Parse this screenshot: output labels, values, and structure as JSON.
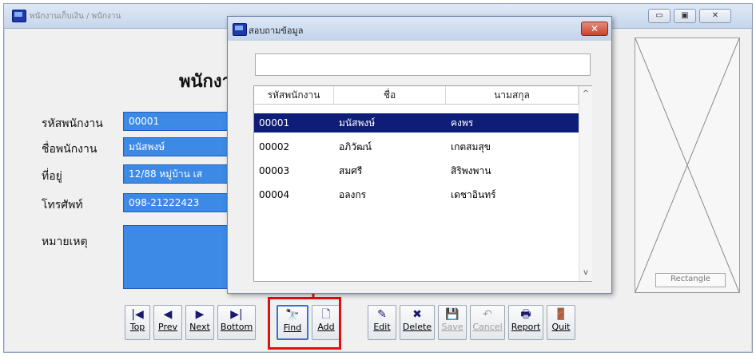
{
  "main_window": {
    "title": "พนักงานเก็บเงิน / พนักงาน",
    "minimize_glyph": "▭",
    "maximize_glyph": "▣",
    "close_glyph": "✕"
  },
  "form": {
    "title": "พนักงาน",
    "fields": [
      {
        "label": "รหัสพนักงาน",
        "value": "00001"
      },
      {
        "label": "ชื่อพนักงาน",
        "value": "มนัสพงษ์"
      },
      {
        "label": "ที่อยู่",
        "value": "12/88 หมู่บ้าน เส"
      },
      {
        "label": "โทรศัพท์",
        "value": "098-21222423"
      },
      {
        "label": "หมายเหตุ",
        "value": ""
      }
    ],
    "photo_caption": "Rectangle"
  },
  "toolbar": {
    "buttons": [
      {
        "label": "Top",
        "icon": "|◀",
        "disabled": false
      },
      {
        "label": "Prev",
        "icon": "◀",
        "disabled": false
      },
      {
        "label": "Next",
        "icon": "▶",
        "disabled": false
      },
      {
        "label": "Bottom",
        "icon": "▶|",
        "disabled": false
      },
      {
        "label": "Find",
        "icon": "🔭",
        "disabled": false
      },
      {
        "label": "Add",
        "icon": "🗋",
        "disabled": false
      },
      {
        "label": "Edit",
        "icon": "✎",
        "disabled": false
      },
      {
        "label": "Delete",
        "icon": "✖",
        "disabled": false
      },
      {
        "label": "Save",
        "icon": "💾",
        "disabled": true
      },
      {
        "label": "Cancel",
        "icon": "↶",
        "disabled": true
      },
      {
        "label": "Report",
        "icon": "🖶",
        "disabled": false
      },
      {
        "label": "Quit",
        "icon": "🚪",
        "disabled": false
      }
    ]
  },
  "search_dialog": {
    "title": "สอบถามข้อมูล",
    "close_glyph": "✕",
    "search_value": "",
    "columns": [
      "รหัสพนักงาน",
      "ชื่อ",
      "นามสกุล"
    ],
    "rows": [
      [
        "00001",
        "มนัสพงษ์",
        "คงพร"
      ],
      [
        "00002",
        "อภิวัฒน์",
        "เกตสมสุข"
      ],
      [
        "00003",
        "สมศรี",
        "สิริพงพาน"
      ],
      [
        "00004",
        "อลงกร",
        "เดชาอินทร์"
      ]
    ],
    "selected_row": 0,
    "scroll_up": "^",
    "scroll_down": "v"
  }
}
